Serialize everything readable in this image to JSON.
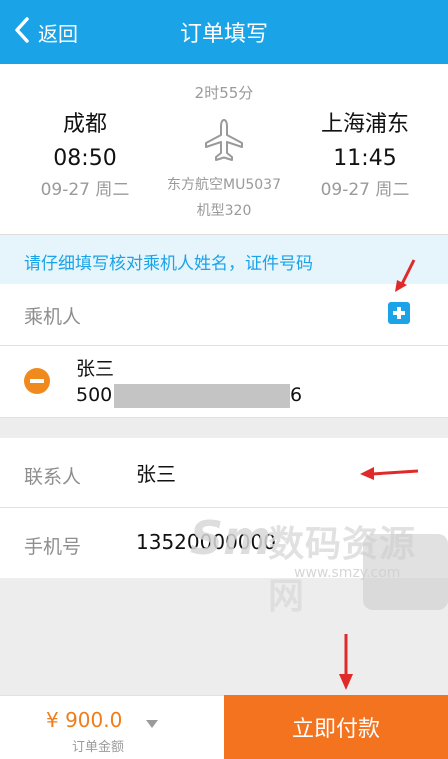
{
  "header": {
    "back_label": "返回",
    "title": "订单填写",
    "back_icon": "chevron-left-icon"
  },
  "flight": {
    "duration": "2时55分",
    "departure": {
      "city": "成都",
      "time": "08:50",
      "date": "09-27 周二"
    },
    "arrival": {
      "city": "上海浦东",
      "time": "11:45",
      "date": "09-27 周二"
    },
    "flight_number": "东方航空MU5037",
    "aircraft": "机型320",
    "plane_icon": "airplane-icon"
  },
  "notice": "请仔细填写核对乘机人姓名，证件号码",
  "passenger_section": {
    "label": "乘机人",
    "add_icon": "plus-square-icon",
    "passengers": [
      {
        "name": "张三",
        "id_prefix": "500",
        "id_suffix": "6"
      }
    ]
  },
  "contact": {
    "contact_label": "联系人",
    "contact_value": "张三",
    "phone_label": "手机号",
    "phone_value": "13520000000"
  },
  "watermark": {
    "logo": "Sm",
    "text": "数码资源网",
    "url": "www.smzy.com"
  },
  "footer": {
    "price": "¥ 900.0",
    "price_label": "订单金额",
    "pay_label": "立即付款"
  },
  "colors": {
    "header": "#1ba3e8",
    "accent_orange": "#f4731f",
    "price_orange": "#f07d1a",
    "arrow_red": "#e02a2a"
  }
}
